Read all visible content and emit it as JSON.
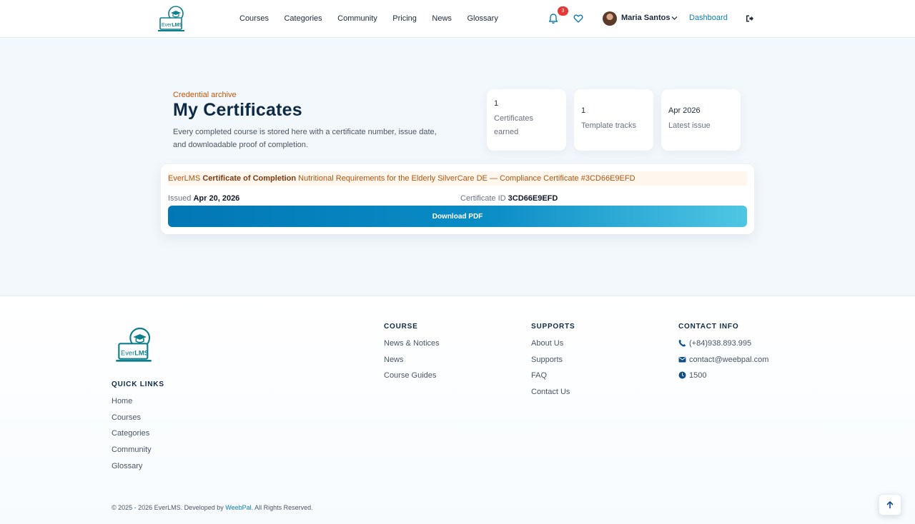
{
  "header": {
    "nav": [
      "Courses",
      "Categories",
      "Community",
      "Pricing",
      "News",
      "Glossary"
    ],
    "notification_count": "3",
    "user_name": "Maria Santos",
    "dashboard_label": "Dashboard"
  },
  "hero": {
    "eyebrow": "Credential archive",
    "title": "My Certificates",
    "description": "Every completed course is stored here with a certificate number, issue date, and downloadable proof of completion."
  },
  "stats": [
    {
      "value": "1",
      "label": "Certificates earned"
    },
    {
      "value": "1",
      "label": "Template tracks"
    },
    {
      "value": "Apr 2026",
      "label": "Latest issue"
    }
  ],
  "certificate": {
    "brand": "EverLMS",
    "type": "Certificate of Completion",
    "course": "Nutritional Requirements for the Elderly SilverCare DE — Compliance Certificate #3CD66E9EFD",
    "issued_label": "Issued",
    "issued_date": "Apr 20, 2026",
    "id_label": "Certificate ID",
    "id_value": "3CD66E9EFD",
    "download_label": "Download PDF"
  },
  "footer": {
    "quick_links_title": "QUICK LINKS",
    "quick_links": [
      "Home",
      "Courses",
      "Categories",
      "Community",
      "Glossary"
    ],
    "course_title": "COURSE",
    "course_links": [
      "News & Notices",
      "News",
      "Course Guides"
    ],
    "supports_title": "SUPPORTS",
    "supports_links": [
      "About Us",
      "Supports",
      "FAQ",
      "Contact Us"
    ],
    "contact_title": "CONTACT INFO",
    "phone": "(+84)938.893.995",
    "email": "contact@weebpal.com",
    "hours": "1500",
    "copyright_prefix": "© 2025 - 2026 EverLMS. Developed by",
    "developer": "WeebPal",
    "copyright_suffix": ". All Rights Reserved."
  },
  "logo": {
    "text_ever": "Ever",
    "text_lms": "LMS"
  },
  "colors": {
    "accent": "#0e7fb0",
    "brand_orange": "#c2560a",
    "badge": "#e53935"
  }
}
